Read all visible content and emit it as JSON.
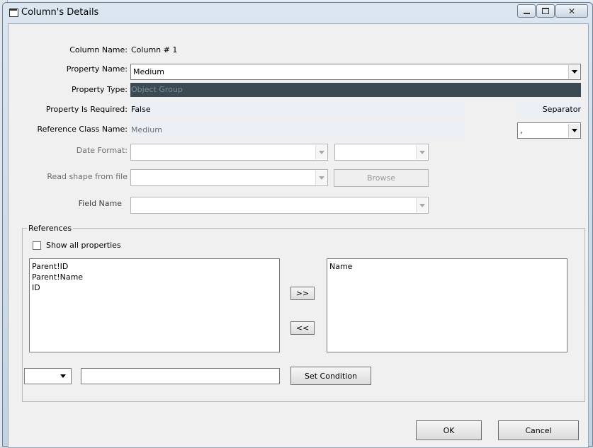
{
  "window": {
    "title": "Column's Details"
  },
  "form": {
    "column_name_label": "Column Name:",
    "column_name_value": "Column # 1",
    "property_name_label": "Property Name:",
    "property_name_value": "Medium",
    "property_type_label": "Property Type:",
    "property_type_value": "Object Group",
    "property_required_label": "Property Is Required:",
    "property_required_value": "False",
    "reference_class_label": "Reference Class Name:",
    "reference_class_value": "Medium",
    "separator_label": "Separator",
    "separator_value": ",",
    "date_format_label": "Date Format:",
    "read_shape_label": "Read shape from file",
    "browse_label": "Browse",
    "field_name_label": "Field Name"
  },
  "references": {
    "group_label": "References",
    "show_all_label": "Show all properties",
    "show_all_checked": false,
    "available": [
      "Parent!ID",
      "Parent!Name",
      "ID"
    ],
    "selected": [
      "Name"
    ],
    "add_label": ">>",
    "remove_label": "<<",
    "set_condition_label": "Set Condition"
  },
  "buttons": {
    "ok_label": "OK",
    "cancel_label": "Cancel"
  },
  "colors": {
    "property_type_bg": "#3c4a53",
    "property_type_fg": "#7c8e98",
    "readonly_bg": "#eaf0f6"
  }
}
